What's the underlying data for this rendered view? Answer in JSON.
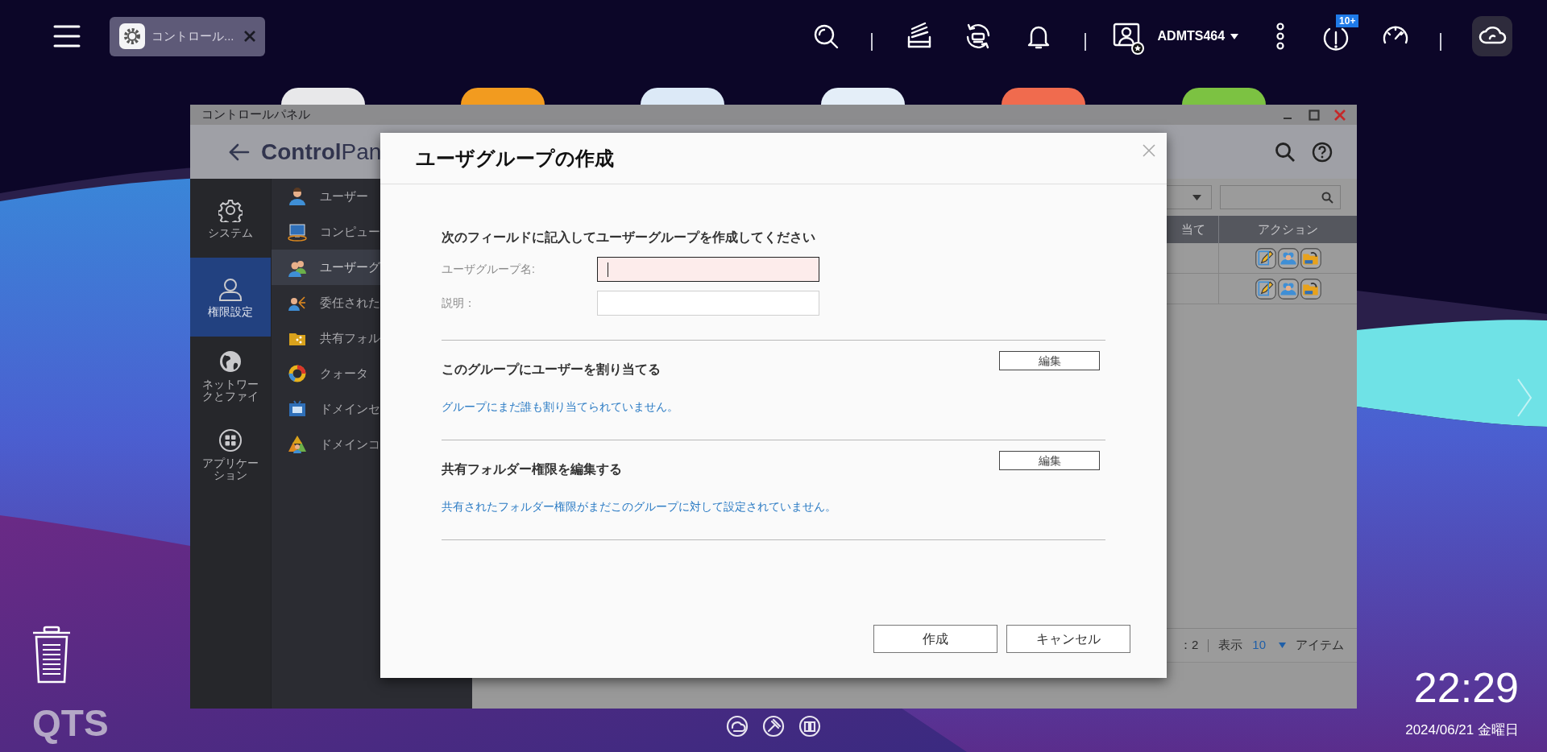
{
  "taskbar": {
    "tabs": [
      {
        "label": "コントロール...",
        "selected": true
      }
    ],
    "user": "ADMTS464",
    "badge": "10+"
  },
  "window": {
    "title": "コントロールパネル",
    "heading": "**Control**Pan",
    "categories": [
      {
        "label": "システム",
        "selected": false
      },
      {
        "label": "権限設定",
        "selected": true
      },
      {
        "label": "ネットワークとファイ",
        "selected": false
      },
      {
        "label": "アプリケーション",
        "selected": false
      }
    ],
    "menu": [
      {
        "label": "ユーザー",
        "selected": false
      },
      {
        "label": "コンピュー",
        "selected": false
      },
      {
        "label": "ユーザーグ",
        "selected": true
      },
      {
        "label": "委任された",
        "selected": false
      },
      {
        "label": "共有フォル",
        "selected": false
      },
      {
        "label": "クォータ",
        "selected": false
      },
      {
        "label": "ドメインセ",
        "selected": false
      },
      {
        "label": "ドメインコ",
        "selected": false
      }
    ],
    "table": {
      "columns": [
        "当て",
        "アクション"
      ],
      "rows": [
        {
          "selected": false
        },
        {
          "selected": false
        }
      ]
    },
    "footer": {
      "count": "：2",
      "show_label": "表示",
      "page_size": "10",
      "unit": "アイテム"
    }
  },
  "dialog": {
    "title": "ユーザグループの作成",
    "intro": "次のフィールドに記入してユーザーグループを作成してください",
    "fields": [
      {
        "label": "ユーザグループ名:",
        "invalid": true,
        "focused": true
      },
      {
        "label": "説明：",
        "invalid": false,
        "focused": false
      }
    ],
    "sections": [
      {
        "heading": "このグループにユーザーを割り当てる",
        "button": "編集",
        "message": "グループにまだ誰も割り当てられていません。"
      },
      {
        "heading": "共有フォルダー権限を編集する",
        "button": "編集",
        "message": "共有されたフォルダー権限がまだこのグループに対して設定されていません。"
      }
    ],
    "buttons": [
      {
        "label": "作成"
      },
      {
        "label": "キャンセル"
      }
    ]
  },
  "desktop": {
    "logo": "QTS",
    "clock": "22:29",
    "date": "2024/06/21 金曜日"
  }
}
